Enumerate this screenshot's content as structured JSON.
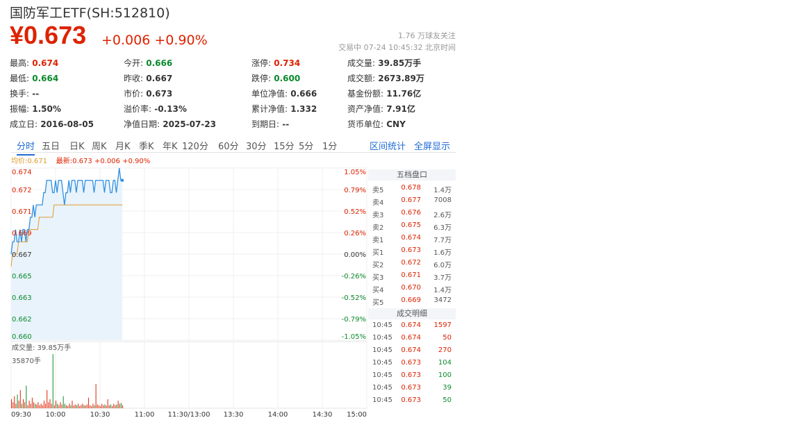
{
  "header": {
    "title": "国防军工ETF(SH:512810)",
    "price": "¥0.673",
    "change": "+0.006 +0.90%",
    "followers": "1.76 万球友关注",
    "status": "交易中 07-24 10:45:32 北京时间"
  },
  "quote": [
    [
      {
        "label": "最高:",
        "value": "0.674",
        "color": "red"
      },
      {
        "label": "今开:",
        "value": "0.666",
        "color": "green"
      },
      {
        "label": "涨停:",
        "value": "0.734",
        "color": "red"
      },
      {
        "label": "成交量:",
        "value": "39.85万手",
        "color": "black"
      }
    ],
    [
      {
        "label": "最低:",
        "value": "0.664",
        "color": "green"
      },
      {
        "label": "昨收:",
        "value": "0.667",
        "color": "black"
      },
      {
        "label": "跌停:",
        "value": "0.600",
        "color": "green"
      },
      {
        "label": "成交额:",
        "value": "2673.89万",
        "color": "black"
      }
    ],
    [
      {
        "label": "换手:",
        "value": "--",
        "color": "black"
      },
      {
        "label": "市价:",
        "value": "0.673",
        "color": "black"
      },
      {
        "label": "单位净值:",
        "value": "0.666",
        "color": "black"
      },
      {
        "label": "基金份额:",
        "value": "11.76亿",
        "color": "black"
      }
    ],
    [
      {
        "label": "振幅:",
        "value": "1.50%",
        "color": "black"
      },
      {
        "label": "溢价率:",
        "value": "-0.13%",
        "color": "black"
      },
      {
        "label": "累计净值:",
        "value": "1.332",
        "color": "black"
      },
      {
        "label": "资产净值:",
        "value": "7.91亿",
        "color": "black"
      }
    ],
    [
      {
        "label": "成立日:",
        "value": "2016-08-05",
        "color": "black"
      },
      {
        "label": "净值日期:",
        "value": "2025-07-23",
        "color": "black"
      },
      {
        "label": "到期日:",
        "value": "--",
        "color": "black"
      },
      {
        "label": "货币单位:",
        "value": "CNY",
        "color": "black"
      }
    ]
  ],
  "tabs": [
    "分时",
    "五日",
    "日K",
    "周K",
    "月K",
    "季K",
    "年K",
    "120分",
    "60分",
    "30分",
    "15分",
    "5分",
    "1分"
  ],
  "tab_links": [
    "区间统计",
    "全屏显示"
  ],
  "legend": {
    "avg": "均价:0.671",
    "last": "最新:0.673 +0.006 +0.90%"
  },
  "volume_label": "成交量: 39.85万手",
  "volume_max_label": "35870手",
  "orderbook": {
    "title": "五档盘口",
    "asks": [
      {
        "label": "卖5",
        "price": "0.678",
        "vol": "1.4万"
      },
      {
        "label": "卖4",
        "price": "0.677",
        "vol": "7008"
      },
      {
        "label": "卖3",
        "price": "0.676",
        "vol": "2.6万"
      },
      {
        "label": "卖2",
        "price": "0.675",
        "vol": "6.3万"
      },
      {
        "label": "卖1",
        "price": "0.674",
        "vol": "7.7万"
      }
    ],
    "bids": [
      {
        "label": "买1",
        "price": "0.673",
        "vol": "1.6万"
      },
      {
        "label": "买2",
        "price": "0.672",
        "vol": "6.0万"
      },
      {
        "label": "买3",
        "price": "0.671",
        "vol": "3.7万"
      },
      {
        "label": "买4",
        "price": "0.670",
        "vol": "1.4万"
      },
      {
        "label": "买5",
        "price": "0.669",
        "vol": "3472"
      }
    ],
    "trades_title": "成交明细",
    "trades": [
      {
        "time": "10:45",
        "price": "0.674",
        "vol": "1597",
        "dir": "red"
      },
      {
        "time": "10:45",
        "price": "0.674",
        "vol": "50",
        "dir": "red"
      },
      {
        "time": "10:45",
        "price": "0.674",
        "vol": "270",
        "dir": "red"
      },
      {
        "time": "10:45",
        "price": "0.673",
        "vol": "104",
        "dir": "green"
      },
      {
        "time": "10:45",
        "price": "0.673",
        "vol": "100",
        "dir": "green"
      },
      {
        "time": "10:45",
        "price": "0.673",
        "vol": "39",
        "dir": "green"
      },
      {
        "time": "10:45",
        "price": "0.673",
        "vol": "50",
        "dir": "green"
      }
    ]
  },
  "colors": {
    "up": "#dd2200",
    "down": "#0a8a2b",
    "price_line": "#2f8fdf",
    "avg_line": "#e09a2a",
    "accent": "#1f6bd6"
  },
  "chart_data": {
    "type": "line",
    "title": "",
    "x_ticks": [
      "09:30",
      "10:00",
      "10:30",
      "11:00",
      "11:30/13:00",
      "13:30",
      "14:00",
      "14:30",
      "15:00"
    ],
    "y_left_ticks": [
      "0.674",
      "0.672",
      "0.671",
      "0.669",
      "0.667",
      "0.665",
      "0.663",
      "0.662",
      "0.660"
    ],
    "y_right_ticks": [
      "1.05%",
      "0.79%",
      "0.52%",
      "0.26%",
      "0.00%",
      "-0.26%",
      "-0.52%",
      "-0.79%",
      "-1.05%"
    ],
    "ylim": [
      0.66,
      0.674
    ],
    "prev_close": 0.667,
    "session_minutes": 240,
    "series": [
      {
        "minutes": [
          0,
          1,
          2,
          3,
          4,
          5,
          6,
          7,
          8,
          9,
          10,
          11,
          12,
          13,
          14,
          15,
          16,
          17,
          18,
          19,
          20,
          21,
          22,
          23,
          24,
          25,
          26,
          27,
          28,
          29,
          30,
          31,
          32,
          33,
          34,
          35,
          36,
          37,
          38,
          39,
          40,
          41,
          42,
          43,
          44,
          45,
          46,
          47,
          48,
          49,
          50,
          51,
          52,
          53,
          54,
          55,
          56,
          57,
          58,
          59,
          60,
          61,
          62,
          63,
          64,
          65,
          66,
          67,
          68,
          69,
          70,
          71,
          72,
          73,
          74,
          75
        ],
        "values": [
          0.667,
          0.668,
          0.668,
          0.669,
          0.668,
          0.668,
          0.669,
          0.668,
          0.669,
          0.669,
          0.668,
          0.669,
          0.669,
          0.67,
          0.67,
          0.671,
          0.67,
          0.671,
          0.671,
          0.671,
          0.671,
          0.671,
          0.672,
          0.672,
          0.673,
          0.673,
          0.673,
          0.673,
          0.672,
          0.672,
          0.673,
          0.672,
          0.673,
          0.673,
          0.673,
          0.672,
          0.671,
          0.672,
          0.672,
          0.673,
          0.672,
          0.673,
          0.673,
          0.673,
          0.672,
          0.673,
          0.673,
          0.673,
          0.673,
          0.672,
          0.673,
          0.673,
          0.673,
          0.673,
          0.673,
          0.673,
          0.672,
          0.673,
          0.673,
          0.673,
          0.673,
          0.673,
          0.673,
          0.672,
          0.673,
          0.673,
          0.673,
          0.672,
          0.672,
          0.673,
          0.673,
          0.672,
          0.673,
          0.674,
          0.673,
          0.673
        ]
      },
      {
        "minutes": [
          0,
          1,
          2,
          3,
          4,
          5,
          6,
          7,
          8,
          9,
          10,
          11,
          12,
          13,
          14,
          15,
          16,
          17,
          18,
          19,
          20,
          21,
          22,
          23,
          24,
          25,
          26,
          27,
          28,
          29,
          30,
          31,
          32,
          33,
          34,
          35,
          36,
          37,
          38,
          39,
          40,
          41,
          42,
          43,
          44,
          45,
          46,
          47,
          48,
          49,
          50,
          51,
          52,
          53,
          54,
          55,
          56,
          57,
          58,
          59,
          60,
          61,
          62,
          63,
          64,
          65,
          66,
          67,
          68,
          69,
          70,
          71,
          72,
          73,
          74,
          75
        ],
        "values": [
          0.666,
          0.667,
          0.667,
          0.667,
          0.667,
          0.668,
          0.668,
          0.668,
          0.668,
          0.668,
          0.668,
          0.668,
          0.669,
          0.669,
          0.669,
          0.669,
          0.669,
          0.669,
          0.669,
          0.67,
          0.67,
          0.67,
          0.67,
          0.67,
          0.67,
          0.67,
          0.67,
          0.67,
          0.67,
          0.671,
          0.671,
          0.671,
          0.671,
          0.671,
          0.671,
          0.671,
          0.671,
          0.671,
          0.671,
          0.671,
          0.671,
          0.671,
          0.671,
          0.671,
          0.671,
          0.671,
          0.671,
          0.671,
          0.671,
          0.671,
          0.671,
          0.671,
          0.671,
          0.671,
          0.671,
          0.671,
          0.671,
          0.671,
          0.671,
          0.671,
          0.671,
          0.671,
          0.671,
          0.671,
          0.671,
          0.671,
          0.671,
          0.671,
          0.671,
          0.671,
          0.671,
          0.671,
          0.671,
          0.671,
          0.671,
          0.671
        ]
      }
    ],
    "volume": {
      "max": 35870,
      "values": [
        6000,
        4000,
        8000,
        3000,
        9000,
        5000,
        12000,
        3000,
        6000,
        4000,
        15000,
        2000,
        5000,
        3000,
        7000,
        4000,
        3000,
        2500,
        4000,
        2000,
        3000,
        2000,
        5000,
        3000,
        12000,
        4000,
        6000,
        3000,
        35870,
        2000,
        5000,
        3000,
        2000,
        4000,
        2500,
        8000,
        3000,
        2000,
        1500,
        3000,
        2000,
        5000,
        1800,
        2500,
        2000,
        3000,
        1500,
        2200,
        3000,
        2000,
        1800,
        2500,
        7000,
        2000,
        1500,
        3000,
        2000,
        16000,
        2500,
        2000,
        1500,
        3000,
        2000,
        2500,
        1800,
        6000,
        2000,
        2500,
        1500,
        3000,
        2000,
        2500,
        5000,
        3000,
        3500,
        2000
      ]
    }
  }
}
